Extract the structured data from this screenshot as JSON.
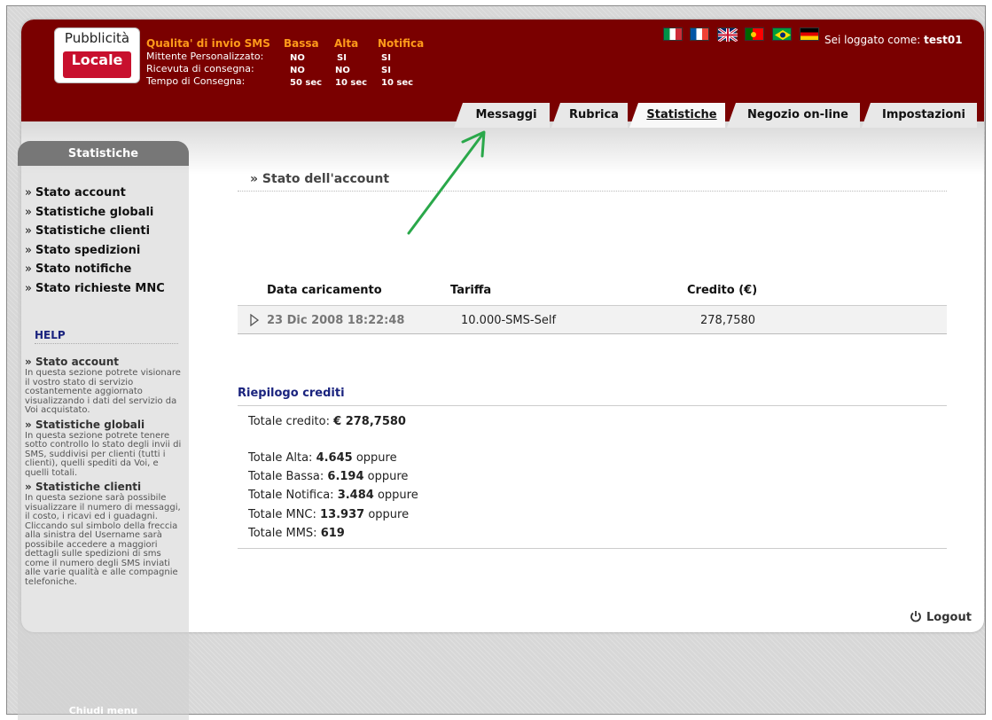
{
  "logo": {
    "line1": "Pubblicità",
    "line2": "Locale"
  },
  "quality": {
    "title": "Qualita' di invio SMS",
    "columns": [
      "Bassa",
      "Alta",
      "Notifica"
    ],
    "rows": [
      {
        "label": "Mittente Personalizzato:",
        "values": [
          "NO",
          "SI",
          "SI"
        ]
      },
      {
        "label": "Ricevuta di consegna:",
        "values": [
          "NO",
          "NO",
          "SI"
        ]
      },
      {
        "label": "Tempo di Consegna:",
        "values": [
          "50 sec",
          "10 sec",
          "10 sec"
        ]
      }
    ]
  },
  "flags": [
    "flag-it-icon",
    "flag-fr-icon",
    "flag-uk-icon",
    "flag-pt-icon",
    "flag-br-icon",
    "flag-de-icon"
  ],
  "login": {
    "prefix": "Sei loggato come: ",
    "user": "test01"
  },
  "tabs": [
    {
      "label": "Messaggi"
    },
    {
      "label": "Rubrica"
    },
    {
      "label": "Statistiche"
    },
    {
      "label": "Negozio on-line"
    },
    {
      "label": "Impostazioni"
    }
  ],
  "sidebar": {
    "title": "Statistiche",
    "items": [
      {
        "label": "Stato account"
      },
      {
        "label": "Statistiche globali"
      },
      {
        "label": "Statistiche clienti"
      },
      {
        "label": "Stato spedizioni"
      },
      {
        "label": "Stato notifiche"
      },
      {
        "label": "Stato richieste MNC"
      }
    ],
    "help_title": "HELP",
    "help": [
      {
        "title": "Stato account",
        "text": "In questa sezione potrete visionare il vostro stato di servizio costantemente aggiornato visualizzando i dati del servizio da Voi acquistato."
      },
      {
        "title": "Statistiche globali",
        "text": "In questa sezione potrete tenere sotto controllo lo stato degli invii di SMS, suddivisi per clienti (tutti i clienti), quelli spediti da Voi, e quelli totali."
      },
      {
        "title": "Statistiche clienti",
        "text": "In questa sezione sarà possibile visualizzare il numero di messaggi, il costo, i ricavi ed i guadagni. Cliccando sul simbolo della freccia alla sinistra del Username sarà possibile accedere a maggiori dettagli sulle spedizioni di sms come il numero degli SMS inviati alle varie qualità e alle compagnie telefoniche."
      }
    ],
    "close": "Chiudi menu",
    "raquo": "»"
  },
  "main": {
    "section_title": "» Stato dell'account",
    "table": {
      "headers": [
        "Data caricamento",
        "Tariffa",
        "Credito (€)"
      ],
      "row": {
        "date": "23 Dic 2008 18:22:48",
        "tariff": "10.000-SMS-Self",
        "credit": "278,7580"
      }
    },
    "summary": {
      "title": "Riepilogo crediti",
      "total_credit": {
        "label": "Totale credito: ",
        "value": "€ 278,7580"
      },
      "lines": [
        {
          "label": "Totale Alta: ",
          "value": "4.645",
          "suffix": " oppure"
        },
        {
          "label": "Totale Bassa: ",
          "value": "6.194",
          "suffix": " oppure"
        },
        {
          "label": "Totale Notifica: ",
          "value": "3.484",
          "suffix": " oppure"
        },
        {
          "label": "Totale MNC: ",
          "value": "13.937",
          "suffix": " oppure"
        },
        {
          "label": "Totale MMS: ",
          "value": "619",
          "suffix": ""
        }
      ]
    },
    "logout": "Logout"
  },
  "colors": {
    "header": "#7a0000",
    "accent": "#ff9a1a",
    "nav_title": "#1a237e",
    "arrow": "#2aa84a"
  }
}
